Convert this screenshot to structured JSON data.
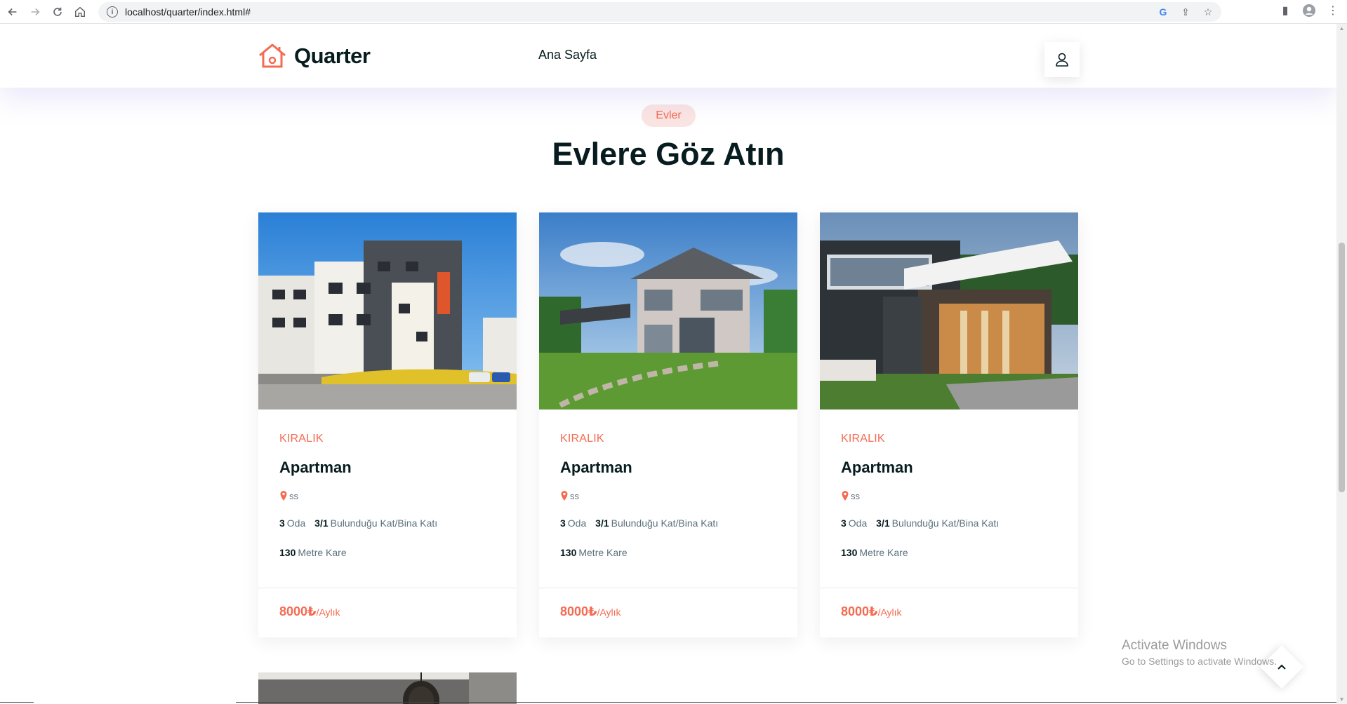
{
  "browser": {
    "url": "localhost/quarter/index.html#"
  },
  "header": {
    "logo_text": "Quarter",
    "nav_items": [
      "Ana Sayfa"
    ]
  },
  "section": {
    "tag": "Evler",
    "title": "Evlere Göz Atın"
  },
  "cards": [
    {
      "status": "KIRALIK",
      "title": "Apartman",
      "location": "ss",
      "rooms_value": "3",
      "rooms_label": "Oda",
      "floor_value": "3/1",
      "floor_label": "Bulunduğu Kat/Bina Katı",
      "area_value": "130",
      "area_label": "Metre Kare",
      "price": "8000₺",
      "price_unit": "/Aylık"
    },
    {
      "status": "KIRALIK",
      "title": "Apartman",
      "location": "ss",
      "rooms_value": "3",
      "rooms_label": "Oda",
      "floor_value": "3/1",
      "floor_label": "Bulunduğu Kat/Bina Katı",
      "area_value": "130",
      "area_label": "Metre Kare",
      "price": "8000₺",
      "price_unit": "/Aylık"
    },
    {
      "status": "KIRALIK",
      "title": "Apartman",
      "location": "ss",
      "rooms_value": "3",
      "rooms_label": "Oda",
      "floor_value": "3/1",
      "floor_label": "Bulunduğu Kat/Bina Katı",
      "area_value": "130",
      "area_label": "Metre Kare",
      "price": "8000₺",
      "price_unit": "/Aylık"
    }
  ],
  "windows_notice": {
    "line1": "Activate Windows",
    "line2": "Go to Settings to activate Windows."
  },
  "colors": {
    "accent": "#f46b52",
    "heading": "#071c1f",
    "text": "#5c727d"
  }
}
